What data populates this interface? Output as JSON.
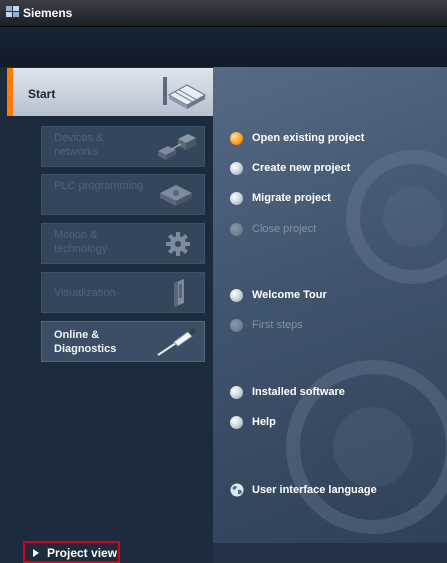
{
  "window": {
    "title": "Siemens"
  },
  "sidebar": {
    "start_label": "Start",
    "portals": [
      {
        "label": "Devices & networks",
        "enabled": false,
        "icon": "devices-networks-icon"
      },
      {
        "label": "PLC programming",
        "enabled": false,
        "icon": "plc-programming-icon"
      },
      {
        "label": "Motion & technology",
        "enabled": false,
        "icon": "motion-gear-icon"
      },
      {
        "label": "Visualization",
        "enabled": false,
        "icon": "visualization-panel-icon"
      },
      {
        "label": "Online & Diagnostics",
        "enabled": true,
        "icon": "diagnostics-probe-icon"
      }
    ],
    "project_view_label": "Project view"
  },
  "actions": {
    "open_existing": "Open existing project",
    "create_new": "Create new project",
    "migrate": "Migrate project",
    "close": "Close project",
    "welcome_tour": "Welcome Tour",
    "first_steps": "First steps",
    "installed_software": "Installed software",
    "help": "Help",
    "ui_language": "User interface language"
  },
  "colors": {
    "accent": "#ff7a00",
    "highlight_frame": "#d8001c",
    "panel_dark": "#1d2b3e",
    "panel_main": "#4a5d78"
  }
}
